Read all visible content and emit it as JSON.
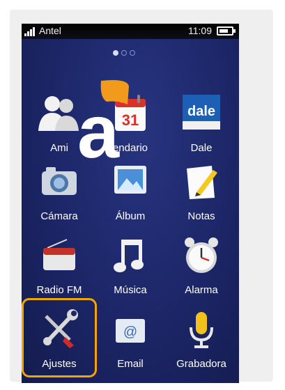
{
  "status_bar": {
    "carrier": "Antel",
    "time": "11:09"
  },
  "home_screen": {
    "page_indicator": {
      "pages": 3,
      "active_page": 1
    },
    "apps": [
      {
        "id": "amigos",
        "label": "Ami",
        "icon": "contacts-icon"
      },
      {
        "id": "calendario",
        "label": "endario",
        "icon": "calendar-icon",
        "icon_text": "31"
      },
      {
        "id": "dale",
        "label": "Dale",
        "icon": "dale-icon",
        "icon_text": "dale"
      },
      {
        "id": "camara",
        "label": "Cámara",
        "icon": "camera-icon"
      },
      {
        "id": "album",
        "label": "Álbum",
        "icon": "photo-album-icon"
      },
      {
        "id": "notas",
        "label": "Notas",
        "icon": "notes-icon"
      },
      {
        "id": "radio",
        "label": "Radio FM",
        "icon": "radio-icon"
      },
      {
        "id": "musica",
        "label": "Música",
        "icon": "music-note-icon"
      },
      {
        "id": "alarma",
        "label": "Alarma",
        "icon": "alarm-clock-icon"
      },
      {
        "id": "ajustes",
        "label": "Ajustes",
        "icon": "wrench-screwdriver-icon"
      },
      {
        "id": "email",
        "label": "Email",
        "icon": "email-icon",
        "icon_text": "@"
      },
      {
        "id": "grabadora",
        "label": "Grabadora",
        "icon": "microphone-icon"
      }
    ]
  },
  "overlay_logo": {
    "text": "a",
    "name": "antel-logo"
  },
  "highlight": {
    "target": "ajustes",
    "color": "#f3a400"
  },
  "colors": {
    "background": "#1c2667",
    "status_bar": "#000000",
    "antel_orange": "#f29a1c",
    "dale_blue": "#1d5fb5"
  }
}
